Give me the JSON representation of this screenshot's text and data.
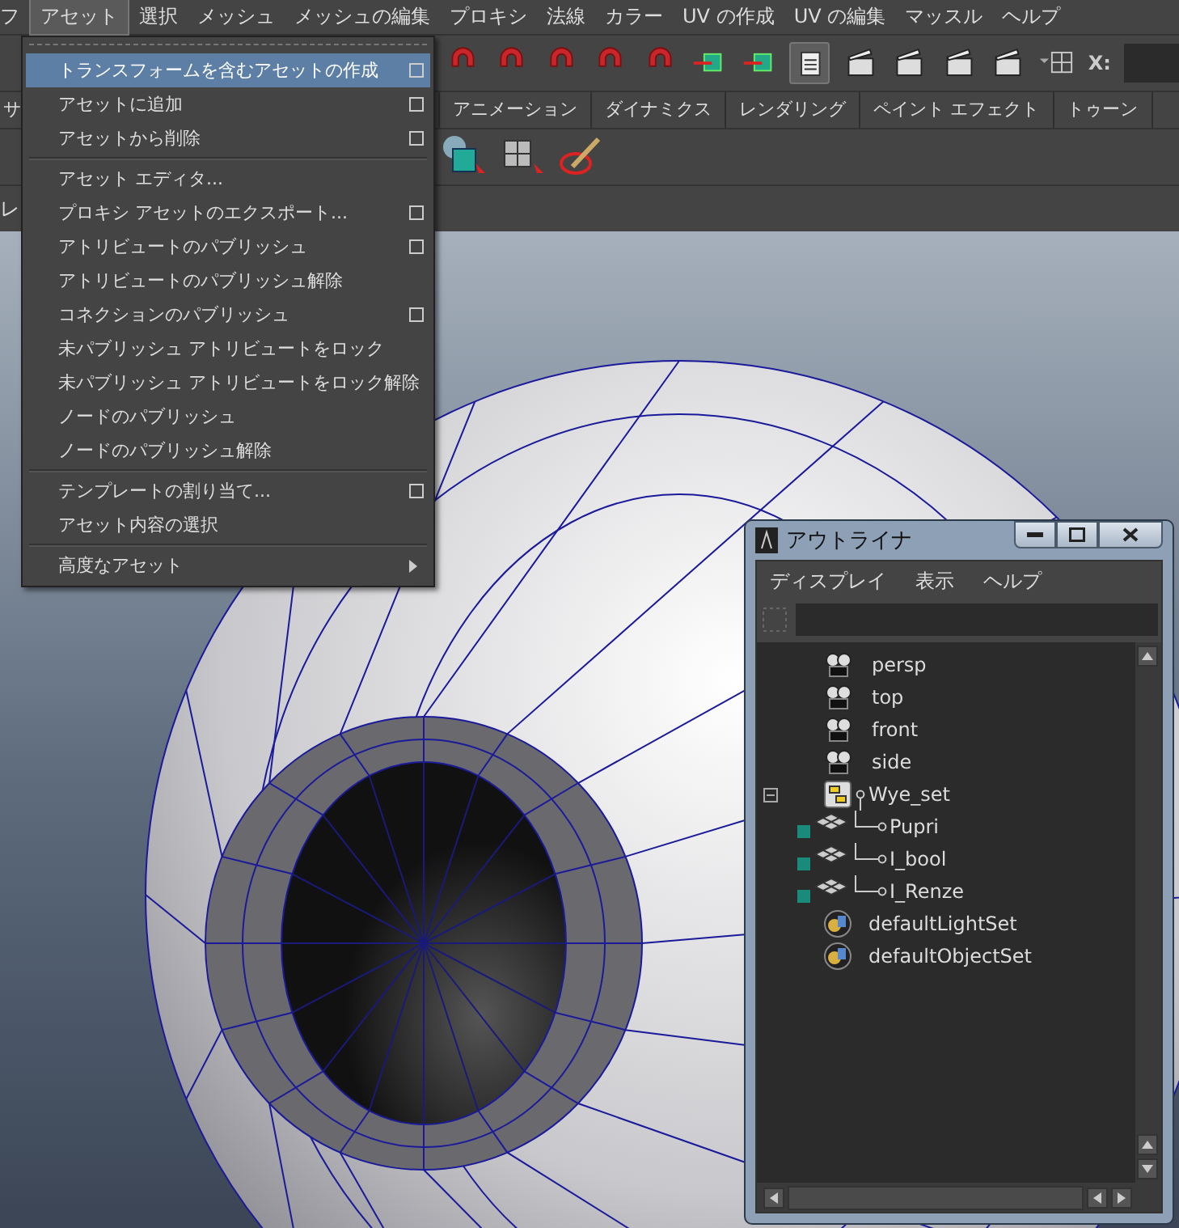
{
  "menubar": [
    {
      "label": "フ",
      "selected": false
    },
    {
      "label": "アセット",
      "selected": true
    },
    {
      "label": "選択",
      "selected": false
    },
    {
      "label": "メッシュ",
      "selected": false
    },
    {
      "label": "メッシュの編集",
      "selected": false
    },
    {
      "label": "プロキシ",
      "selected": false
    },
    {
      "label": "法線",
      "selected": false
    },
    {
      "label": "カラー",
      "selected": false
    },
    {
      "label": "UV の作成",
      "selected": false
    },
    {
      "label": "UV の編集",
      "selected": false
    },
    {
      "label": "マッスル",
      "selected": false
    },
    {
      "label": "ヘルプ",
      "selected": false
    }
  ],
  "toolbar": {
    "coord_label": "X:"
  },
  "shelf_tabs": [
    {
      "label": "サ",
      "selected": false
    },
    {
      "label": "アニメーション",
      "selected": false
    },
    {
      "label": "ダイナミクス",
      "selected": false
    },
    {
      "label": "レンダリング",
      "selected": false
    },
    {
      "label": "ペイント エフェクト",
      "selected": false
    },
    {
      "label": "トゥーン",
      "selected": false
    }
  ],
  "side_label": "レ",
  "asset_menu": {
    "sections": [
      [
        {
          "label": "トランスフォームを含むアセットの作成",
          "kind": "option",
          "highlighted": true
        },
        {
          "label": "アセットに追加",
          "kind": "option",
          "highlighted": false
        },
        {
          "label": "アセットから削除",
          "kind": "option",
          "highlighted": false
        }
      ],
      [
        {
          "label": "アセット エディタ...",
          "kind": "plain",
          "highlighted": false
        },
        {
          "label": "プロキシ アセットのエクスポート...",
          "kind": "option",
          "highlighted": false
        },
        {
          "label": "アトリビュートのパブリッシュ",
          "kind": "option",
          "highlighted": false
        },
        {
          "label": "アトリビュートのパブリッシュ解除",
          "kind": "plain",
          "highlighted": false
        },
        {
          "label": "コネクションのパブリッシュ",
          "kind": "option",
          "highlighted": false
        },
        {
          "label": "未パブリッシュ アトリビュートをロック",
          "kind": "plain",
          "highlighted": false
        },
        {
          "label": "未パブリッシュ アトリビュートをロック解除",
          "kind": "plain",
          "highlighted": false
        },
        {
          "label": "ノードのパブリッシュ",
          "kind": "plain",
          "highlighted": false
        },
        {
          "label": "ノードのパブリッシュ解除",
          "kind": "plain",
          "highlighted": false
        }
      ],
      [
        {
          "label": "テンプレートの割り当て...",
          "kind": "option",
          "highlighted": false
        },
        {
          "label": "アセット内容の選択",
          "kind": "plain",
          "highlighted": false
        }
      ],
      [
        {
          "label": "高度なアセット",
          "kind": "submenu",
          "highlighted": false
        }
      ]
    ]
  },
  "outliner": {
    "title": "アウトライナ",
    "menu": [
      "ディスプレイ",
      "表示",
      "ヘルプ"
    ],
    "items": [
      {
        "label": "persp",
        "kind": "camera"
      },
      {
        "label": "top",
        "kind": "camera"
      },
      {
        "label": "front",
        "kind": "camera"
      },
      {
        "label": "side",
        "kind": "camera"
      },
      {
        "label": "Wye_set",
        "kind": "set",
        "expanded": true,
        "children": [
          {
            "label": "Pupri",
            "kind": "mesh"
          },
          {
            "label": "I_bool",
            "kind": "mesh"
          },
          {
            "label": "I_Renze",
            "kind": "mesh"
          }
        ]
      },
      {
        "label": "defaultLightSet",
        "kind": "object_set"
      },
      {
        "label": "defaultObjectSet",
        "kind": "object_set"
      }
    ]
  }
}
